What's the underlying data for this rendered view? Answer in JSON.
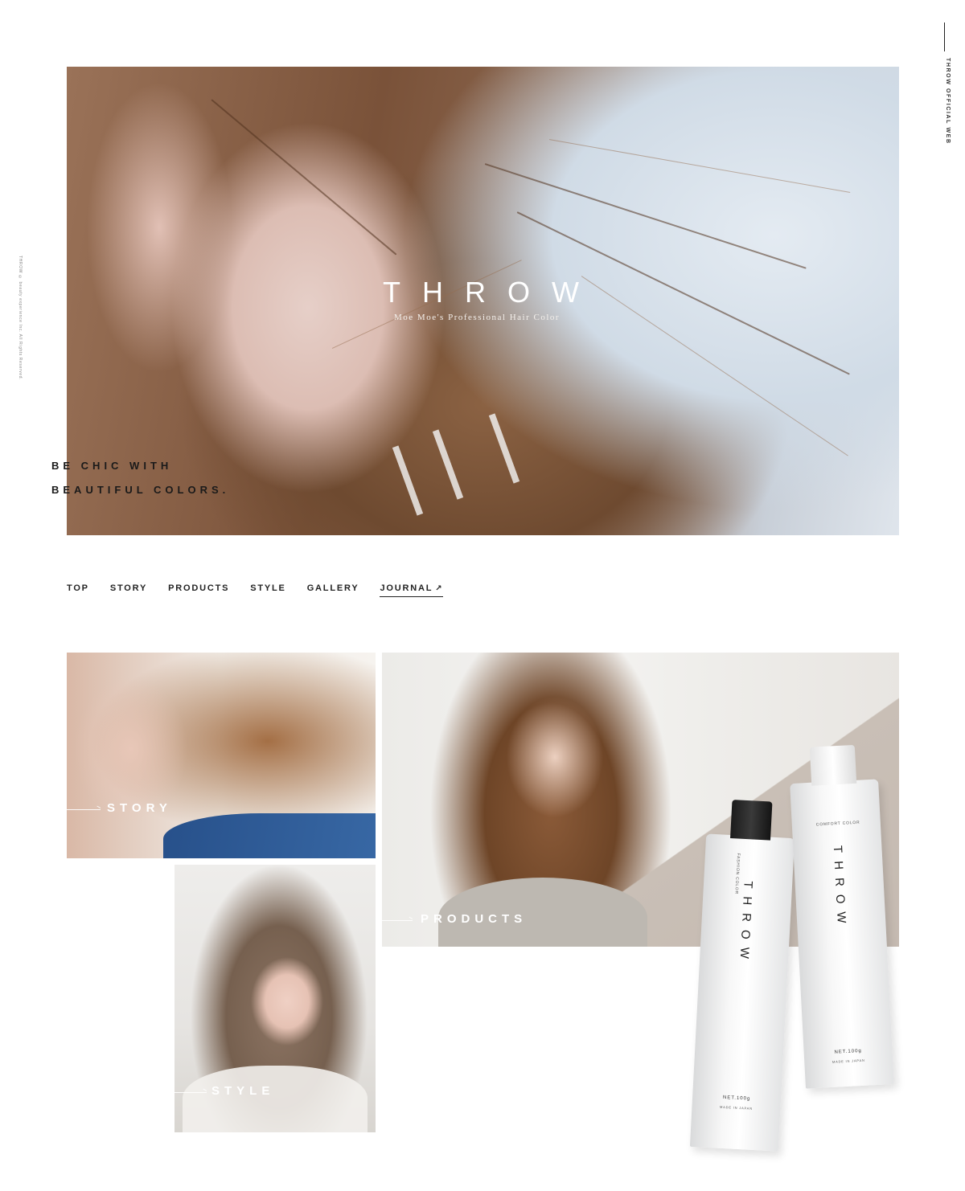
{
  "side": {
    "brand": "THROW OFFICIAL WEB",
    "copyright": "THROW © beauty experience Inc. All Rights Reserved."
  },
  "hero": {
    "logo": "THROW",
    "subtitle": "Moe Moe's Professional Hair Color",
    "tagline_line1": "BE CHIC WITH",
    "tagline_line2": "BEAUTIFUL COLORS."
  },
  "nav": {
    "items": [
      {
        "label": "TOP"
      },
      {
        "label": "STORY"
      },
      {
        "label": "PRODUCTS"
      },
      {
        "label": "STYLE"
      },
      {
        "label": "GALLERY"
      },
      {
        "label": "JOURNAL",
        "external_icon": "external-link-icon"
      }
    ]
  },
  "panels": {
    "story": "STORY",
    "products": "PRODUCTS",
    "style": "STYLE"
  },
  "tubes": {
    "fashion": {
      "kind": "FASHION COLOR",
      "brand": "THROW",
      "net": "NET.100g",
      "made": "MADE IN JAPAN"
    },
    "comfort": {
      "kind": "COMFORT COLOR",
      "brand": "THROW",
      "net": "NET.100g",
      "made": "MADE IN JAPAN"
    }
  },
  "colors": {
    "text": "#222222",
    "background": "#ffffff",
    "label": "#ffffff"
  }
}
